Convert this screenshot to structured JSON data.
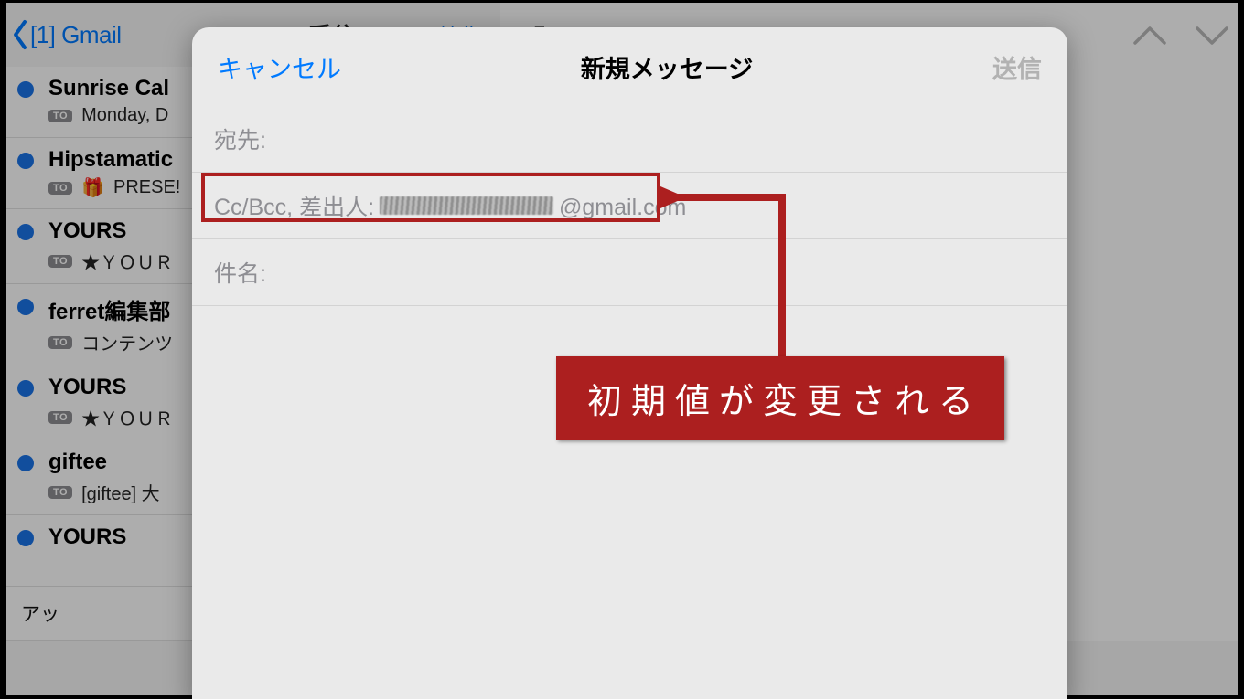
{
  "left": {
    "back_title": "[1] Gmail"
  },
  "mid": {
    "title": "受信",
    "edit_label": "編集",
    "update_label": "アッ",
    "items": [
      {
        "sender": "Sunrise Cal",
        "preview": "Monday, D",
        "gift": false
      },
      {
        "sender": "Hipstamatic",
        "preview": "PRESE!",
        "gift": true
      },
      {
        "sender": "YOURS",
        "preview": "★ＹＯＵＲ",
        "gift": false
      },
      {
        "sender": "ferret編集部",
        "preview": "コンテンツ",
        "gift": false
      },
      {
        "sender": "YOURS",
        "preview": "★ＹＯＵＲ",
        "gift": false
      },
      {
        "sender": "giftee",
        "preview": "[giftee] 大",
        "gift": false
      },
      {
        "sender": "YOURS",
        "preview": "",
        "gift": false
      }
    ],
    "to_badge": "TO"
  },
  "compose": {
    "cancel": "キャンセル",
    "title": "新規メッセージ",
    "send": "送信",
    "to_label": "宛先:",
    "cc_label": "Cc/Bcc, 差出人:",
    "from_suffix": "@gmail.com",
    "subject_label": "件名:"
  },
  "annotation": {
    "text": "初期値が変更される"
  }
}
